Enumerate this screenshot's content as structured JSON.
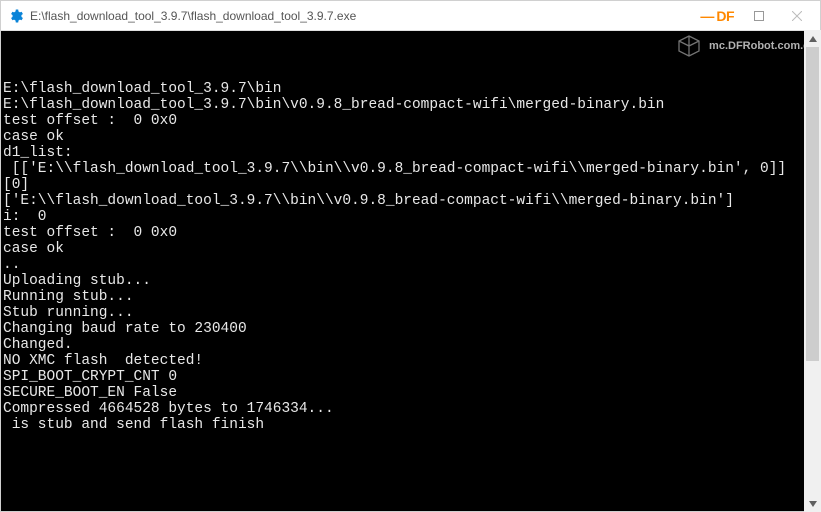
{
  "window": {
    "title": "E:\\flash_download_tool_3.9.7\\flash_download_tool_3.9.7.exe"
  },
  "watermark": {
    "text": "mc.DFRobot.com.cn",
    "df": "DF"
  },
  "console_lines": [
    "E:\\flash_download_tool_3.9.7\\bin",
    "E:\\flash_download_tool_3.9.7\\bin\\v0.9.8_bread-compact-wifi\\merged-binary.bin",
    "test offset :  0 0x0",
    "case ok",
    "d1_list:",
    " [['E:\\\\flash_download_tool_3.9.7\\\\bin\\\\v0.9.8_bread-compact-wifi\\\\merged-binary.bin', 0]]",
    "[0]",
    "['E:\\\\flash_download_tool_3.9.7\\\\bin\\\\v0.9.8_bread-compact-wifi\\\\merged-binary.bin']",
    "i:  0",
    "test offset :  0 0x0",
    "case ok",
    "..",
    "Uploading stub...",
    "Running stub...",
    "Stub running...",
    "Changing baud rate to 230400",
    "Changed.",
    "NO XMC flash  detected!",
    "SPI_BOOT_CRYPT_CNT 0",
    "SECURE_BOOT_EN False",
    "Compressed 4664528 bytes to 1746334...",
    "",
    " is stub and send flash finish"
  ]
}
